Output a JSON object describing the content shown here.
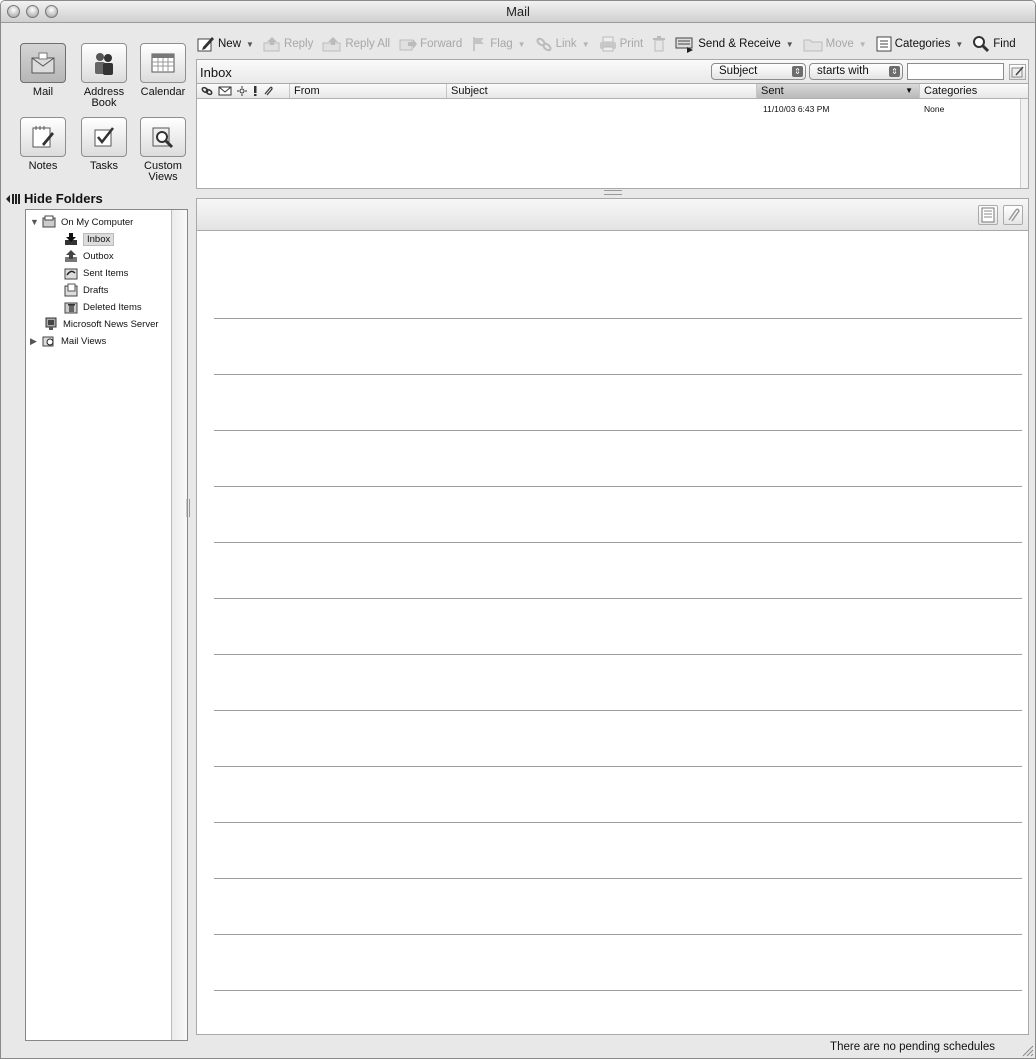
{
  "window": {
    "title": "Mail"
  },
  "nav": {
    "buttons": [
      {
        "label": "Mail",
        "icon": "mail-icon",
        "selected": true
      },
      {
        "label": "Address Book",
        "icon": "address-book-icon",
        "selected": false
      },
      {
        "label": "Calendar",
        "icon": "calendar-icon",
        "selected": false
      },
      {
        "label": "Notes",
        "icon": "notes-icon",
        "selected": false
      },
      {
        "label": "Tasks",
        "icon": "tasks-icon",
        "selected": false
      },
      {
        "label": "Custom Views",
        "icon": "custom-views-icon",
        "selected": false
      }
    ],
    "hide_folders": "Hide Folders"
  },
  "folders": {
    "root": "On My Computer",
    "items": [
      "Inbox",
      "Outbox",
      "Sent Items",
      "Drafts",
      "Deleted Items"
    ],
    "selected": "Inbox",
    "news_server": "Microsoft News Server",
    "mail_views": "Mail Views"
  },
  "toolbar": {
    "new": "New",
    "reply": "Reply",
    "reply_all": "Reply All",
    "forward": "Forward",
    "flag": "Flag",
    "link": "Link",
    "print": "Print",
    "send_receive": "Send & Receive",
    "move": "Move",
    "categories": "Categories",
    "find": "Find"
  },
  "inbox": {
    "title": "Inbox",
    "filter_field": "Subject",
    "filter_op": "starts with",
    "search_value": ""
  },
  "columns": {
    "from": "From",
    "subject": "Subject",
    "sent": "Sent",
    "categories": "Categories"
  },
  "messages": [
    {
      "from": "",
      "subject": "",
      "sent": "11/10/03 6:43 PM",
      "categories": "None"
    }
  ],
  "status": {
    "text": "There are no pending schedules"
  }
}
